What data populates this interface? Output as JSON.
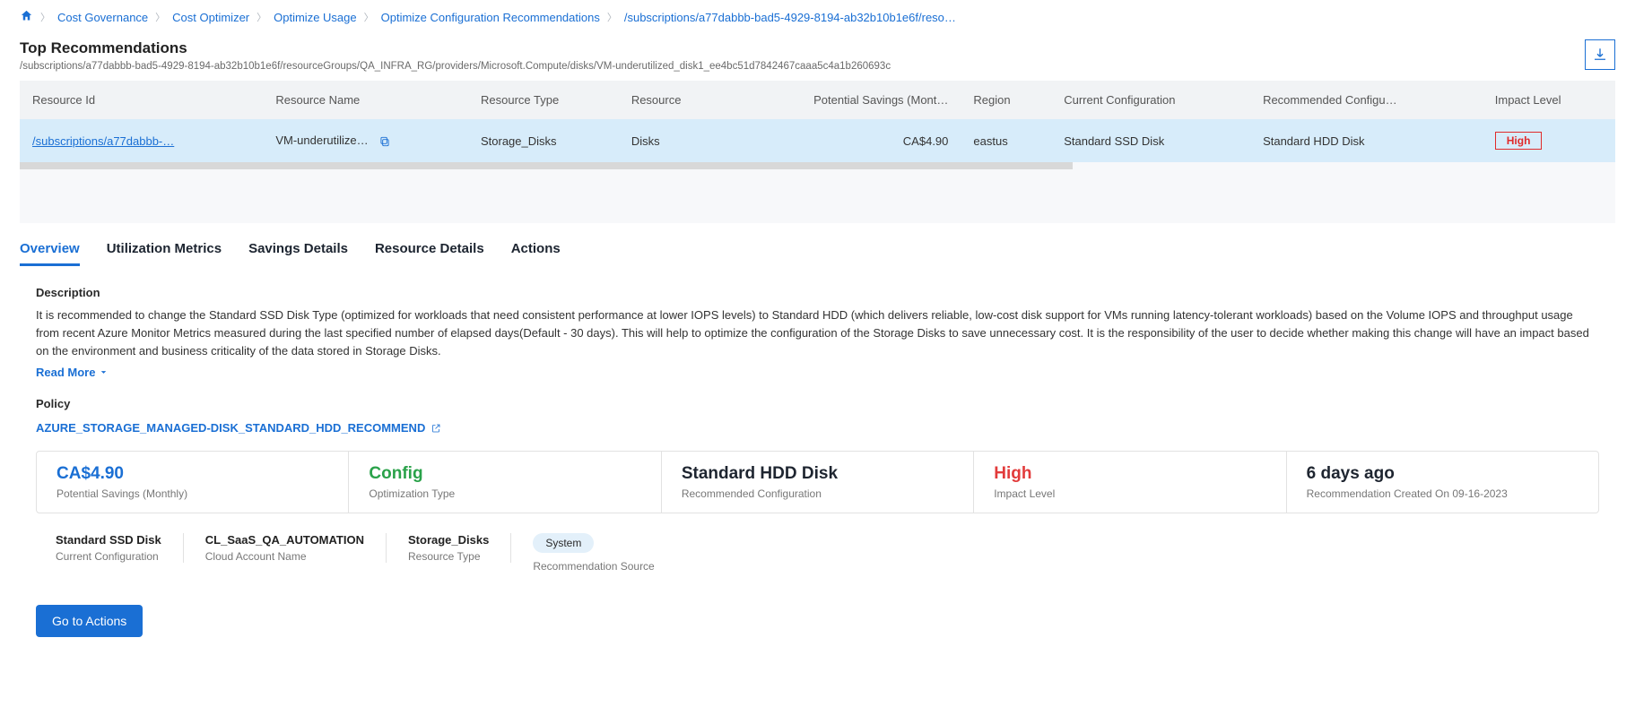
{
  "breadcrumb": {
    "items": [
      {
        "label": "Cost Governance"
      },
      {
        "label": "Cost Optimizer"
      },
      {
        "label": "Optimize Usage"
      },
      {
        "label": "Optimize Configuration Recommendations"
      },
      {
        "label": "/subscriptions/a77dabbb-bad5-4929-8194-ab32b10b1e6f/reso…"
      }
    ]
  },
  "header": {
    "title": "Top Recommendations",
    "subtitle": "/subscriptions/a77dabbb-bad5-4929-8194-ab32b10b1e6f/resourceGroups/QA_INFRA_RG/providers/Microsoft.Compute/disks/VM-underutilized_disk1_ee4bc51d7842467caaa5c4a1b260693c"
  },
  "table": {
    "columns": [
      "Resource Id",
      "Resource Name",
      "Resource Type",
      "Resource",
      "Potential Savings (Mont…",
      "Region",
      "Current Configuration",
      "Recommended Configu…",
      "Impact Level"
    ],
    "row": {
      "resource_id": "/subscriptions/a77dabbb-…",
      "resource_name": "VM-underutilize…",
      "resource_type": "Storage_Disks",
      "resource": "Disks",
      "potential_savings": "CA$4.90",
      "region": "eastus",
      "current_config": "Standard SSD Disk",
      "recommended_config": "Standard HDD Disk",
      "impact_level": "High"
    }
  },
  "tabs": [
    {
      "label": "Overview",
      "active": true
    },
    {
      "label": "Utilization Metrics",
      "active": false
    },
    {
      "label": "Savings Details",
      "active": false
    },
    {
      "label": "Resource Details",
      "active": false
    },
    {
      "label": "Actions",
      "active": false
    }
  ],
  "overview": {
    "desc_label": "Description",
    "desc_text": "It is recommended to change the Standard SSD Disk Type (optimized for workloads that need consistent performance at lower IOPS levels) to Standard HDD (which delivers reliable, low-cost disk support for VMs running latency-tolerant workloads) based on the Volume IOPS and throughput usage from recent Azure Monitor Metrics measured during the last specified number of elapsed days(Default - 30 days). This will help to optimize the configuration of the Storage Disks to save unnecessary cost. It is the responsibility of the user to decide whether making this change will have an impact based on the environment and business criticality of the data stored in Storage Disks.",
    "read_more": "Read More",
    "policy_label": "Policy",
    "policy_link": "AZURE_STORAGE_MANAGED-DISK_STANDARD_HDD_RECOMMEND",
    "stats": [
      {
        "value": "CA$4.90",
        "label": "Potential Savings (Monthly)",
        "color": "c-blue"
      },
      {
        "value": "Config",
        "label": "Optimization Type",
        "color": "c-green"
      },
      {
        "value": "Standard HDD Disk",
        "label": "Recommended Configuration",
        "color": "c-black"
      },
      {
        "value": "High",
        "label": "Impact Level",
        "color": "c-red"
      },
      {
        "value": "6 days ago",
        "label": "Recommendation Created On 09-16-2023",
        "color": "c-black"
      }
    ],
    "meta": [
      {
        "value": "Standard SSD Disk",
        "label": "Current Configuration"
      },
      {
        "value": "CL_SaaS_QA_AUTOMATION",
        "label": "Cloud Account Name"
      },
      {
        "value": "Storage_Disks",
        "label": "Resource Type"
      }
    ],
    "source_pill": "System",
    "source_label": "Recommendation Source",
    "go_actions": "Go to Actions"
  }
}
